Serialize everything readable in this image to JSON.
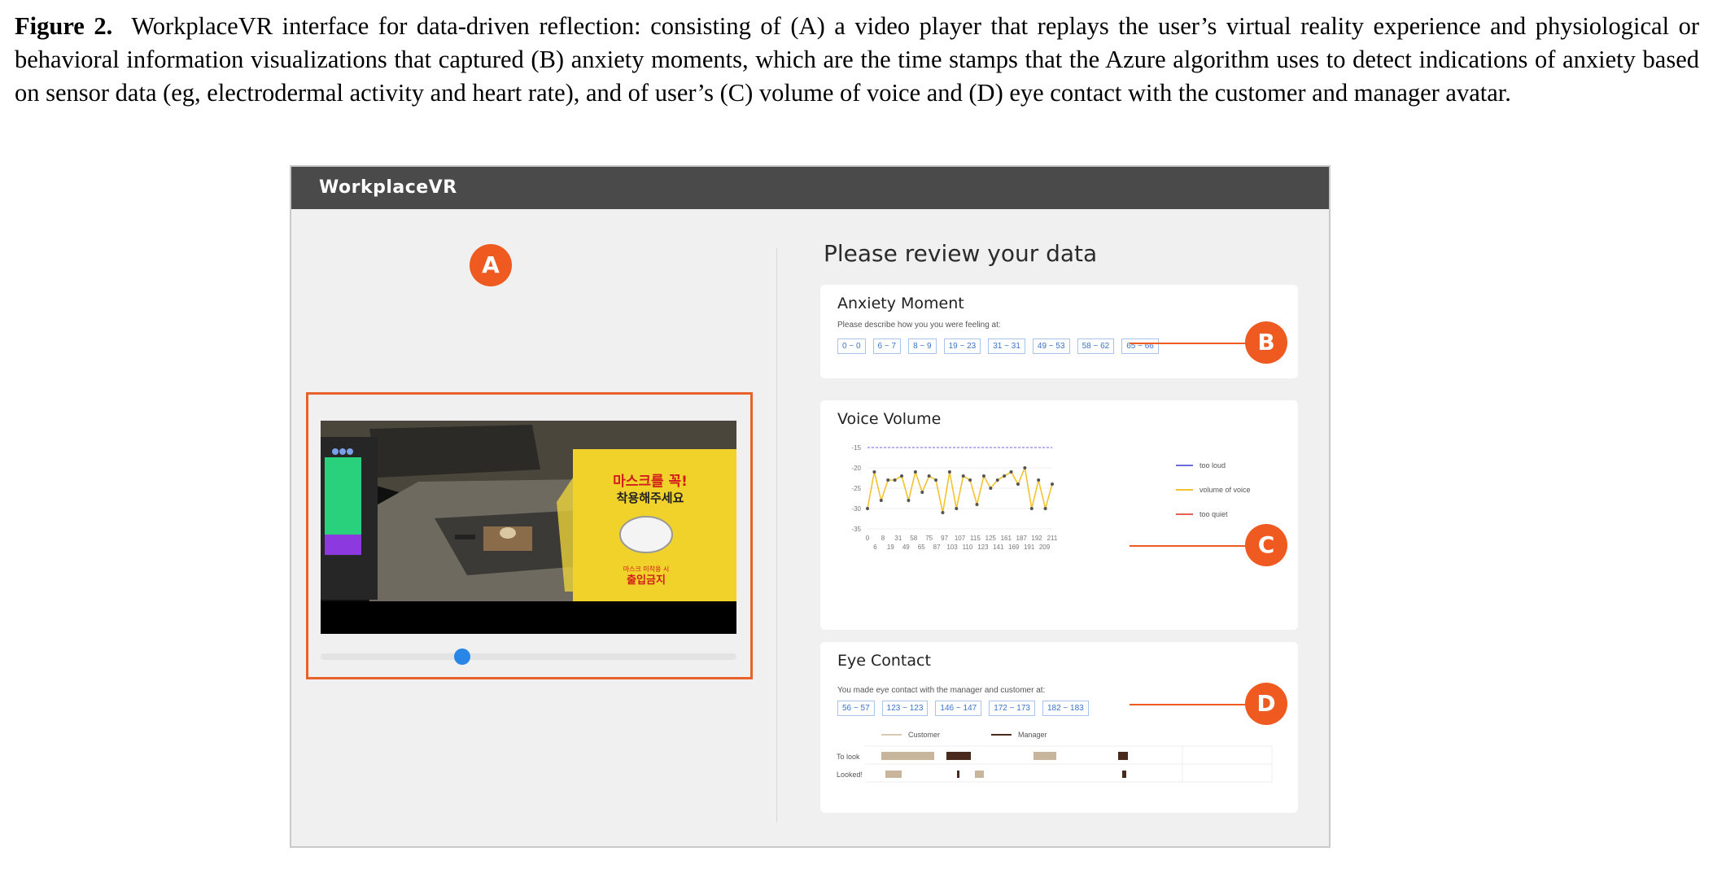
{
  "caption": {
    "label": "Figure 2.",
    "text": "WorkplaceVR interface for data-driven reflection: consisting of (A) a video player that replays the user’s virtual reality experience and physiological or behavioral information visualizations that captured (B) anxiety moments, which are the time stamps that the Azure algorithm uses to detect indications of anxiety based on sensor data (eg, electrodermal activity and heart rate), and of user’s (C) volume of voice and (D) eye contact with the customer and manager avatar."
  },
  "app": {
    "title": "WorkplaceVR"
  },
  "review_title": "Please review your data",
  "badges": {
    "a": "A",
    "b": "B",
    "c": "C",
    "d": "D"
  },
  "video": {
    "slider_position": 0.34,
    "sign_line1": "마스크를 꼭!",
    "sign_line2": "착용해주세요",
    "sign_small": "마스크 미착용 시",
    "sign_bottom": "출입금지",
    "colors": {
      "progress_knob": "#2a86e6",
      "highlight": "#e8622c"
    }
  },
  "anxiety": {
    "title": "Anxiety Moment",
    "prompt": "Please describe how you you were feeling at:",
    "chips": [
      "0 ~ 0",
      "6 ~ 7",
      "8 ~ 9",
      "19 ~ 23",
      "31 ~ 31",
      "49 ~ 53",
      "58 ~ 62",
      "65 ~ 66"
    ]
  },
  "voice": {
    "title": "Voice Volume",
    "legend": [
      "too loud",
      "volume of voice",
      "too quiet"
    ],
    "colors": {
      "too_loud": "#6b6bdc",
      "volume": "#f2c230",
      "too_quiet": "#ec5a5a"
    }
  },
  "chart_data": {
    "type": "line",
    "title": "Voice Volume",
    "ylim": [
      -35,
      -15
    ],
    "yticks": [
      -15,
      -20,
      -25,
      -30,
      -35
    ],
    "xticks_top": [
      "0",
      "8",
      "31",
      "58",
      "75",
      "97",
      "107",
      "115",
      "125",
      "161",
      "187",
      "192",
      "211"
    ],
    "xticks_bottom": [
      "6",
      "19",
      "49",
      "65",
      "87",
      "103",
      "110",
      "123",
      "141",
      "169",
      "191",
      "209"
    ],
    "reference_lines": [
      {
        "name": "too loud",
        "y": -15
      }
    ],
    "series": [
      {
        "name": "volume of voice",
        "values": [
          -30,
          -21,
          -28,
          -23,
          -23,
          -22,
          -28,
          -21,
          -26,
          -22,
          -23,
          -31,
          -21,
          -30,
          -22,
          -23,
          -29,
          -22,
          -25,
          -23,
          -22,
          -21,
          -24,
          -20,
          -30,
          -23,
          -30,
          -24
        ]
      }
    ]
  },
  "eye": {
    "title": "Eye Contact",
    "prompt": "You made eye contact with the manager and customer at:",
    "chips": [
      "56 ~ 57",
      "123 ~ 123",
      "146 ~ 147",
      "172 ~ 173",
      "182 ~ 183"
    ],
    "legend": [
      "Customer",
      "Manager"
    ],
    "rows": [
      "To look",
      "Looked!"
    ],
    "colors": {
      "customer": "#c8b59c",
      "manager": "#4a2a1c"
    }
  }
}
